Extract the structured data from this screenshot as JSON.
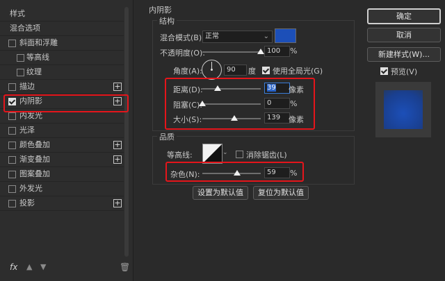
{
  "left_panel": {
    "header": "样式",
    "blend_options": "混合选项",
    "items": [
      {
        "label": "斜面和浮雕",
        "checked": false,
        "plus": false
      },
      {
        "label": "等高线",
        "checked": false,
        "plus": false
      },
      {
        "label": "纹理",
        "checked": false,
        "plus": false
      },
      {
        "label": "描边",
        "checked": false,
        "plus": true
      },
      {
        "label": "内阴影",
        "checked": true,
        "plus": true
      },
      {
        "label": "内发光",
        "checked": false,
        "plus": false
      },
      {
        "label": "光泽",
        "checked": false,
        "plus": false
      },
      {
        "label": "颜色叠加",
        "checked": false,
        "plus": true
      },
      {
        "label": "渐变叠加",
        "checked": false,
        "plus": true
      },
      {
        "label": "图案叠加",
        "checked": false,
        "plus": false
      },
      {
        "label": "外发光",
        "checked": false,
        "plus": false
      },
      {
        "label": "投影",
        "checked": false,
        "plus": true
      }
    ],
    "fx_label": "fx"
  },
  "inner_shadow": {
    "title": "内阴影",
    "structure": {
      "title": "结构",
      "blend_mode_label": "混合模式(B):",
      "blend_mode_value": "正常",
      "color": "#1c4fb8",
      "opacity_label": "不透明度(O):",
      "opacity_value": "100",
      "opacity_unit": "%",
      "opacity_fraction": 1.0,
      "angle_label": "角度(A):",
      "angle_value": "90",
      "angle_unit": "度",
      "global_light_label": "使用全局光(G)",
      "global_light_checked": true,
      "distance_label": "距离(D):",
      "distance_value": "39",
      "distance_unit": "像素",
      "distance_fraction": 0.26,
      "choke_label": "阻塞(C):",
      "choke_value": "0",
      "choke_unit": "%",
      "choke_fraction": 0.0,
      "size_label": "大小(S):",
      "size_value": "139",
      "size_unit": "像素",
      "size_fraction": 0.55
    },
    "quality": {
      "title": "品质",
      "contour_label": "等高线:",
      "antialias_label": "消除锯齿(L)",
      "antialias_checked": false,
      "noise_label": "杂色(N):",
      "noise_value": "59",
      "noise_unit": "%",
      "noise_fraction": 0.59
    },
    "make_default": "设置为默认值",
    "reset_default": "复位为默认值"
  },
  "right_panel": {
    "ok": "确定",
    "cancel": "取消",
    "new_style": "新建样式(W)...",
    "preview_label": "预览(V)",
    "preview_checked": true,
    "preview_color": "#1c4fb8"
  },
  "colors": {
    "highlight": "#e5151b",
    "accent_blue": "#2a64c8"
  }
}
